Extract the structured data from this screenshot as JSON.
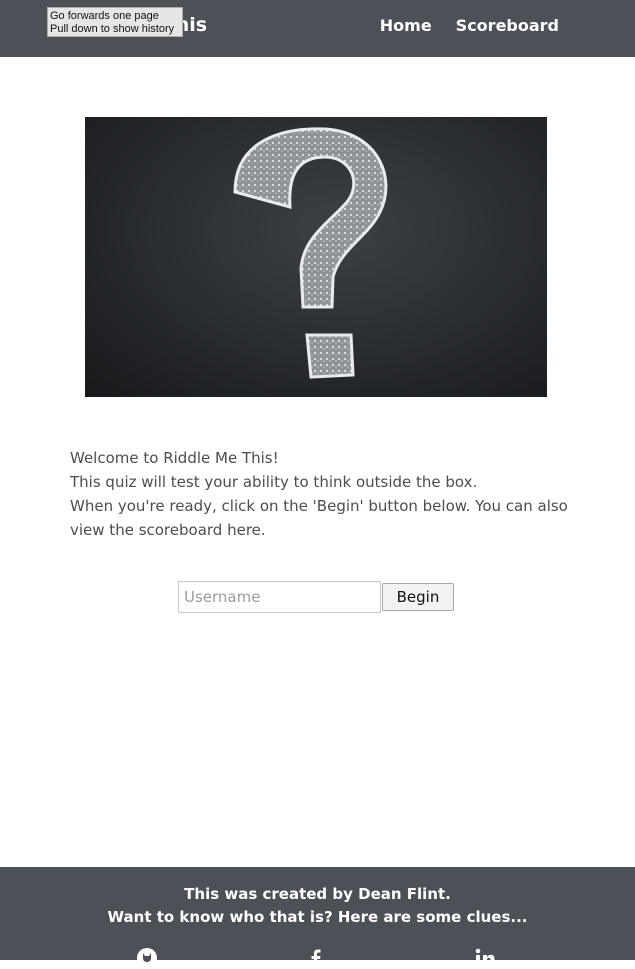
{
  "navbar": {
    "brand": "Riddle Me This",
    "links": [
      "Home",
      "Scoreboard"
    ]
  },
  "tooltip": {
    "line1": "Go forwards one page",
    "line2": "Pull down to show history"
  },
  "hero": {
    "icon": "question-mark-chalkboard"
  },
  "intro": {
    "line1": "Welcome to Riddle Me This!",
    "line2": "This quiz will test your ability to think outside the box.",
    "line3": "When you're ready, click on the 'Begin' button below. You can also view the scoreboard here."
  },
  "form": {
    "username_placeholder": "Username",
    "begin_label": "Begin"
  },
  "footer": {
    "line1": "This was created by Dean Flint.",
    "line2": "Want to know who that is? Here are some clues...",
    "icons": [
      "github-icon",
      "facebook-icon",
      "linkedin-icon"
    ]
  }
}
